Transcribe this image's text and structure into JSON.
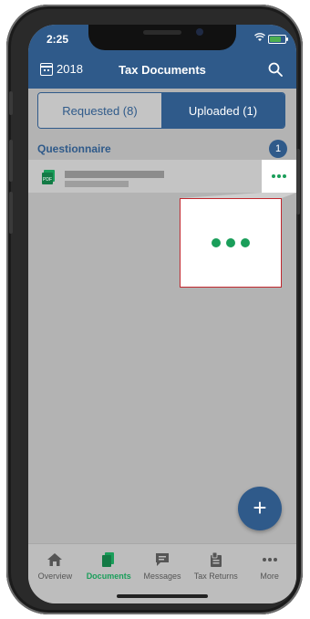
{
  "status": {
    "time": "2:25"
  },
  "header": {
    "year": "2018",
    "title": "Tax Documents"
  },
  "tabs": [
    {
      "label": "Requested (8)",
      "active": false
    },
    {
      "label": "Uploaded (1)",
      "active": true
    }
  ],
  "section": {
    "label": "Questionnaire",
    "count": "1"
  },
  "document": {
    "file_type": "PDF"
  },
  "fab": {
    "label": "+"
  },
  "bottom_nav": [
    {
      "label": "Overview",
      "icon": "home-icon"
    },
    {
      "label": "Documents",
      "icon": "documents-icon",
      "active": true
    },
    {
      "label": "Messages",
      "icon": "messages-icon"
    },
    {
      "label": "Tax Returns",
      "icon": "tax-returns-icon"
    },
    {
      "label": "More",
      "icon": "more-icon"
    }
  ],
  "colors": {
    "brand": "#2f5a8a",
    "accent": "#1a9e5a",
    "highlight_border": "#c0282f"
  }
}
